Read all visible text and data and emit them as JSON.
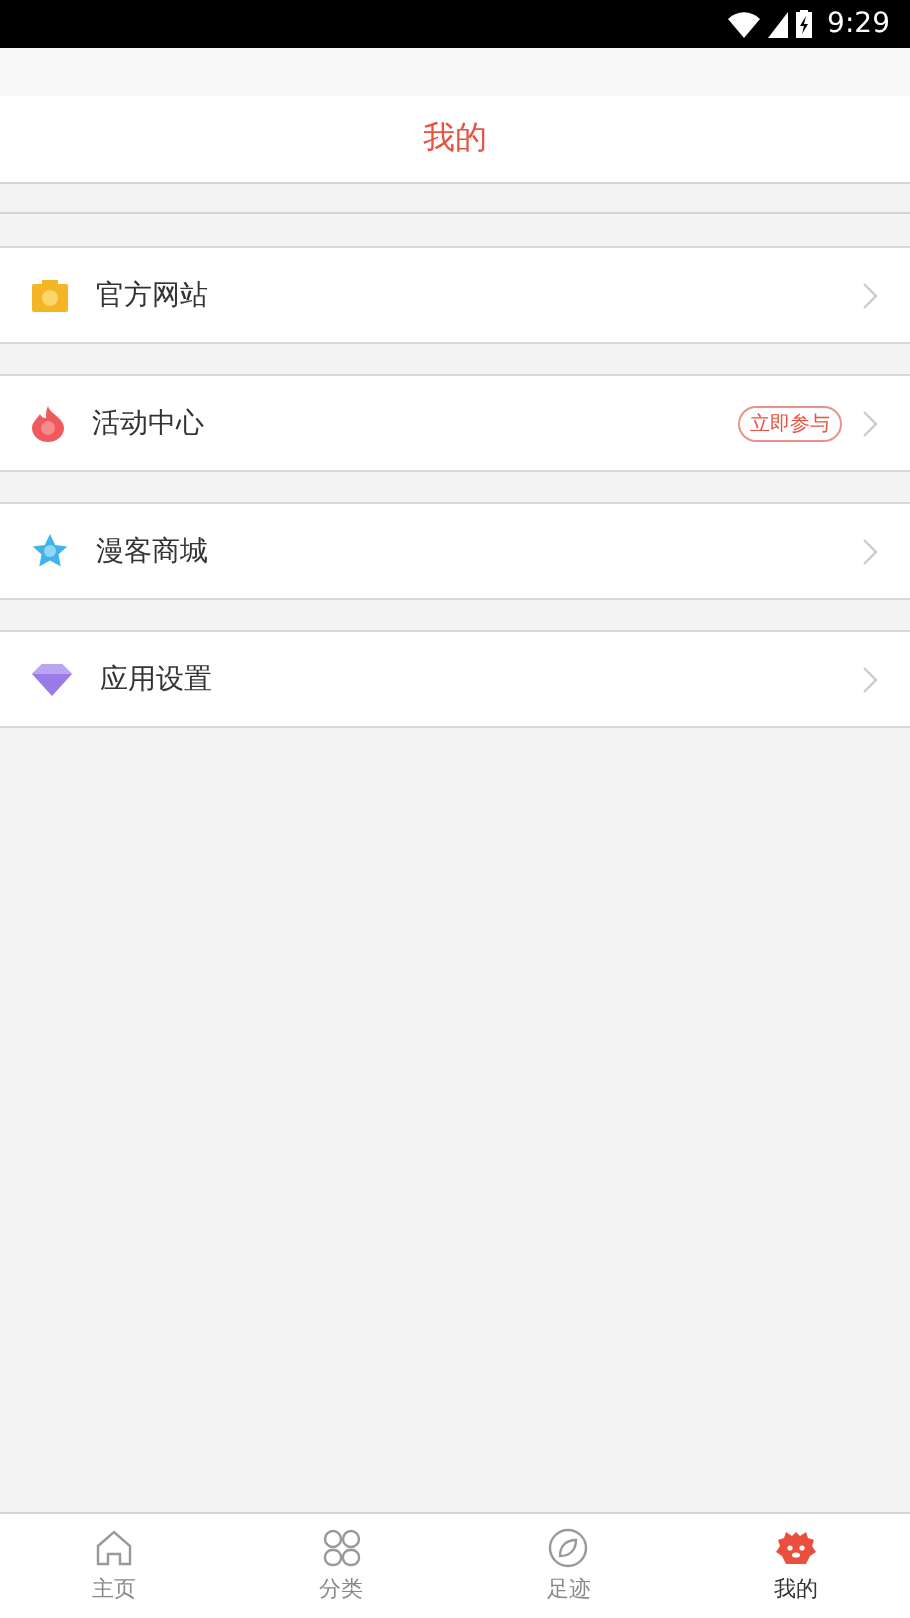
{
  "status_bar": {
    "time": "9:29"
  },
  "header": {
    "title": "我的"
  },
  "menu": [
    {
      "label": "官方网站",
      "kind": "website"
    },
    {
      "label": "活动中心",
      "kind": "activity",
      "badge": "立即参与"
    },
    {
      "label": "漫客商城",
      "kind": "shop"
    },
    {
      "label": "应用设置",
      "kind": "settings"
    }
  ],
  "tabs": [
    {
      "label": "主页",
      "kind": "home",
      "selected": false
    },
    {
      "label": "分类",
      "kind": "category",
      "selected": false
    },
    {
      "label": "足迹",
      "kind": "footprint",
      "selected": false
    },
    {
      "label": "我的",
      "kind": "mine",
      "selected": true
    }
  ]
}
